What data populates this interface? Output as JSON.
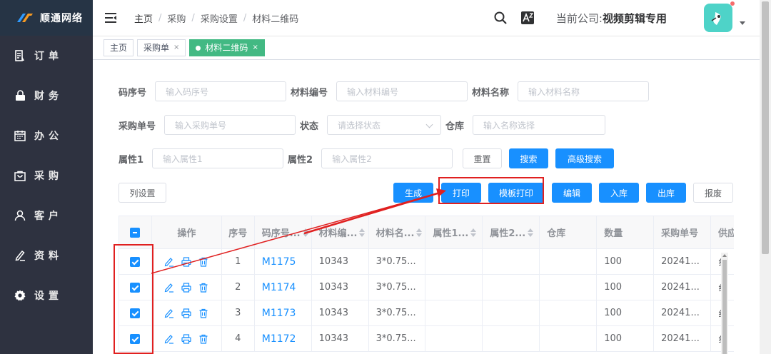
{
  "sidebar": {
    "logo_text": "顺通网络",
    "items": [
      {
        "label": "订单",
        "icon": "order-icon"
      },
      {
        "label": "财务",
        "icon": "lock-icon"
      },
      {
        "label": "办公",
        "icon": "calendar-icon"
      },
      {
        "label": "采购",
        "icon": "bag-icon"
      },
      {
        "label": "客户",
        "icon": "user-icon"
      },
      {
        "label": "资料",
        "icon": "edit-icon"
      },
      {
        "label": "设置",
        "icon": "gear-icon"
      }
    ]
  },
  "header": {
    "breadcrumb": [
      "主页",
      "采购",
      "采购设置",
      "材料二维码"
    ],
    "company_label": "当前公司:",
    "company_name": "视频剪辑专用"
  },
  "tags": [
    {
      "label": "主页"
    },
    {
      "label": "采购单",
      "close": "×"
    },
    {
      "label": "材料二维码",
      "close": "×",
      "active": true
    }
  ],
  "filters": {
    "code_seq_label": "码序号",
    "code_seq_placeholder": "输入码序号",
    "material_no_label": "材料编号",
    "material_no_placeholder": "输入材料编号",
    "material_name_label": "材料名称",
    "material_name_placeholder": "输入材料名称",
    "purchase_no_label": "采购单号",
    "purchase_no_placeholder": "输入采购单号",
    "status_label": "状态",
    "status_placeholder": "请选择状态",
    "warehouse_label": "仓库",
    "warehouse_placeholder": "输入名称选择",
    "attr1_label": "属性1",
    "attr1_placeholder": "输入属性1",
    "attr2_label": "属性2",
    "attr2_placeholder": "输入属性2",
    "reset": "重置",
    "search": "搜索",
    "advanced_search": "高级搜索"
  },
  "toolbar": {
    "column_settings": "列设置",
    "generate": "生成",
    "print": "打印",
    "template_print": "模板打印",
    "edit": "编辑",
    "stock_in": "入库",
    "stock_out": "出库",
    "scrap": "报废"
  },
  "table": {
    "headers": [
      "操作",
      "序号",
      "码序号...",
      "材料编...",
      "材料名...",
      "属性1...",
      "属性2...",
      "仓库",
      "数量",
      "采购单号",
      "供应"
    ],
    "rows": [
      {
        "seq": "1",
        "code": "M1175",
        "material_no": "10343",
        "material_name": "3*0.75...",
        "attr1": "",
        "attr2": "",
        "warehouse": "",
        "qty": "100",
        "purchase_no": "20241...",
        "supplier": "纟"
      },
      {
        "seq": "2",
        "code": "M1174",
        "material_no": "10343",
        "material_name": "3*0.75...",
        "attr1": "",
        "attr2": "",
        "warehouse": "",
        "qty": "100",
        "purchase_no": "20241...",
        "supplier": "纟"
      },
      {
        "seq": "3",
        "code": "M1173",
        "material_no": "10343",
        "material_name": "3*0.75...",
        "attr1": "",
        "attr2": "",
        "warehouse": "",
        "qty": "100",
        "purchase_no": "20241...",
        "supplier": "纟"
      },
      {
        "seq": "4",
        "code": "M1172",
        "material_no": "10343",
        "material_name": "3*0.75...",
        "attr1": "",
        "attr2": "",
        "warehouse": "",
        "qty": "100",
        "purchase_no": "20241...",
        "supplier": "纟"
      }
    ]
  },
  "colors": {
    "primary": "#1890ff",
    "sidebar": "#2e3240",
    "active_tag": "#42b983",
    "annotation": "#e02020"
  }
}
